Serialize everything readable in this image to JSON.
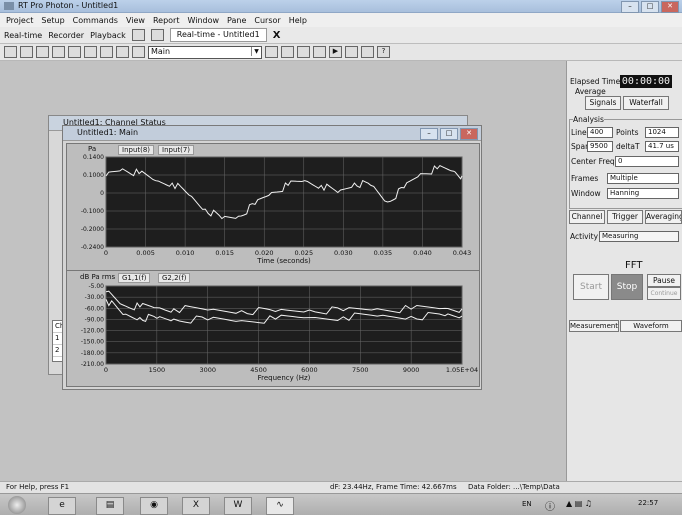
{
  "app": {
    "title": "RT Pro Photon - Untitled1"
  },
  "menu": [
    "Project",
    "Setup",
    "Commands",
    "View",
    "Report",
    "Window",
    "Pane",
    "Cursor",
    "Help"
  ],
  "toolbar": {
    "realtime": "Real-time",
    "recorder": "Recorder",
    "playback": "Playback",
    "doc_tab": "Real-time - Untitled1",
    "doc_tab_close": "X",
    "pane_combo": "Main"
  },
  "windows": {
    "back_title": "Untitled1: Channel Status",
    "main_title": "Untitled1: Main",
    "chan_rows": [
      "1",
      "2"
    ],
    "chan_header": "Ch"
  },
  "time_plot": {
    "ytitle": "Pa",
    "legend": [
      "Input(8)",
      "Input(7)"
    ],
    "yticks": [
      "0.1400",
      "0.1000",
      "0",
      "-0.1000",
      "-0.2000",
      "-0.2400"
    ],
    "xticks": [
      "0",
      "0.005",
      "0.010",
      "0.015",
      "0.020",
      "0.025",
      "0.030",
      "0.035",
      "0.040",
      "0.043"
    ],
    "xlabel": "Time (seconds)"
  },
  "fft_plot": {
    "ytitle": "dB Pa rms",
    "legend": [
      "G1,1(f)",
      "G2,2(f)"
    ],
    "yticks": [
      "-5.00",
      "-30.00",
      "-60.00",
      "-90.00",
      "-120.00",
      "-150.00",
      "-180.00",
      "-210.00"
    ],
    "xticks": [
      "0",
      "1500",
      "3000",
      "4500",
      "6000",
      "7500",
      "9000",
      "1.05E+04"
    ],
    "xlabel": "Frequency (Hz)"
  },
  "chart_data": [
    {
      "type": "line",
      "xlabel": "Time (seconds)",
      "ylabel": "Pa",
      "xlim": [
        0,
        0.043
      ],
      "ylim": [
        -0.24,
        0.14
      ],
      "series": [
        {
          "name": "Input(8)",
          "x": [
            0,
            0.002,
            0.004,
            0.006,
            0.008,
            0.01,
            0.012,
            0.014,
            0.016,
            0.018,
            0.02,
            0.022,
            0.024,
            0.026,
            0.028,
            0.03,
            0.032,
            0.034,
            0.036,
            0.038,
            0.04,
            0.042,
            0.043
          ],
          "values": [
            0.06,
            0.09,
            0.07,
            0.04,
            0.03,
            -0.02,
            -0.08,
            -0.12,
            -0.11,
            -0.06,
            -0.01,
            0.02,
            0.04,
            0.02,
            -0.01,
            0.03,
            0.02,
            -0.05,
            0.01,
            0.07,
            0.09,
            0.08,
            0.06
          ]
        }
      ]
    },
    {
      "type": "line",
      "xlabel": "Frequency (Hz)",
      "ylabel": "dB Pa rms",
      "xlim": [
        0,
        10500
      ],
      "ylim": [
        -210,
        -5
      ],
      "series": [
        {
          "name": "G1,1(f)",
          "x": [
            0,
            500,
            1000,
            1500,
            2000,
            3000,
            4000,
            5000,
            6000,
            7000,
            8000,
            9000,
            10000,
            10500
          ],
          "values": [
            -20,
            -55,
            -60,
            -62,
            -65,
            -68,
            -70,
            -72,
            -68,
            -70,
            -65,
            -66,
            -64,
            -65
          ]
        },
        {
          "name": "G2,2(f)",
          "x": [
            0,
            500,
            1000,
            1500,
            2000,
            3000,
            4000,
            5000,
            6000,
            7000,
            8000,
            9000,
            10000,
            10500
          ],
          "values": [
            -40,
            -80,
            -88,
            -90,
            -92,
            -94,
            -96,
            -92,
            -88,
            -86,
            -84,
            -85,
            -83,
            -84
          ]
        }
      ]
    }
  ],
  "right_panel": {
    "elapsed_label": "Elapsed Time",
    "elapsed_value": "00:00:00",
    "average_label": "Average",
    "signals": "Signals",
    "waterfall": "Waterfall",
    "analysis": "Analysis",
    "lines_label": "Lines",
    "lines_value": "400",
    "points_label": "Points",
    "points_value": "1024",
    "span_label": "Span",
    "span_value": "9500",
    "deltat_label": "deltaT",
    "deltat_value": "41.7 us",
    "center_freq_label": "Center Freq",
    "center_freq_value": "0",
    "frames_label": "Frames",
    "frames_value": "Multiple",
    "window_label": "Window",
    "window_value": "Hanning",
    "tabs": [
      "Channel",
      "Trigger",
      "Averaging"
    ],
    "activity_label": "Activity",
    "activity_value": "Measuring",
    "fft_label": "FFT",
    "start": "Start",
    "stop": "Stop",
    "pause": "Pause",
    "continue": "Continue",
    "bottom_tabs": [
      "Measurement",
      "Waveform Source"
    ]
  },
  "status": {
    "help": "For Help, press F1",
    "frame": "dF: 23.44Hz, Frame Time: 42.667ms",
    "folder": "Data Folder: ...\\Temp\\Data"
  },
  "taskbar": {
    "lang": "EN",
    "clock": "22:57"
  },
  "colors": {
    "plot_bg": "#1e1e1e",
    "trace": "#f0f0f0",
    "grid": "#6a6a6a",
    "timer_bg": "#111111"
  }
}
